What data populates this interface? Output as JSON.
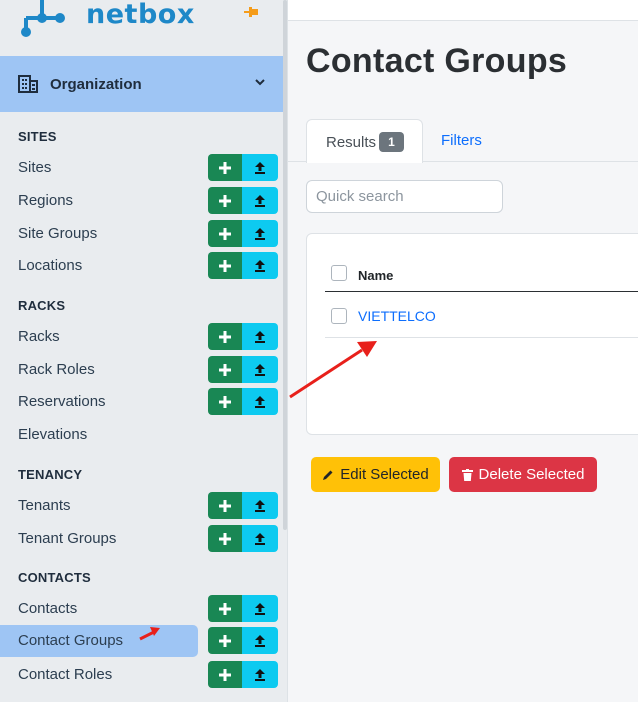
{
  "brand": {
    "name": "netbox"
  },
  "sidebar": {
    "menu_title": "Organization",
    "sections": [
      {
        "title": "SITES",
        "items": [
          {
            "label": "Sites",
            "actions": true
          },
          {
            "label": "Regions",
            "actions": true
          },
          {
            "label": "Site Groups",
            "actions": true
          },
          {
            "label": "Locations",
            "actions": true
          }
        ]
      },
      {
        "title": "RACKS",
        "items": [
          {
            "label": "Racks",
            "actions": true
          },
          {
            "label": "Rack Roles",
            "actions": true
          },
          {
            "label": "Reservations",
            "actions": true
          },
          {
            "label": "Elevations",
            "actions": false
          }
        ]
      },
      {
        "title": "TENANCY",
        "items": [
          {
            "label": "Tenants",
            "actions": true
          },
          {
            "label": "Tenant Groups",
            "actions": true
          }
        ]
      },
      {
        "title": "CONTACTS",
        "items": [
          {
            "label": "Contacts",
            "actions": true
          },
          {
            "label": "Contact Groups",
            "actions": true,
            "active": true
          },
          {
            "label": "Contact Roles",
            "actions": true
          }
        ]
      }
    ]
  },
  "page": {
    "title": "Contact Groups"
  },
  "tabs": {
    "results_label": "Results",
    "results_count": "1",
    "filters_label": "Filters"
  },
  "search": {
    "placeholder": "Quick search"
  },
  "table": {
    "column_name": "Name",
    "rows": [
      {
        "name": "VIETTELCO"
      }
    ]
  },
  "actions": {
    "edit_label": "Edit Selected",
    "delete_label": "Delete Selected"
  },
  "colors": {
    "accent": "#0d6efd",
    "add": "#198754",
    "import": "#0dcaf0",
    "active_bg": "#9ec5f4",
    "edit": "#ffc107",
    "delete": "#dc3545",
    "annotation": "#e8201b"
  }
}
